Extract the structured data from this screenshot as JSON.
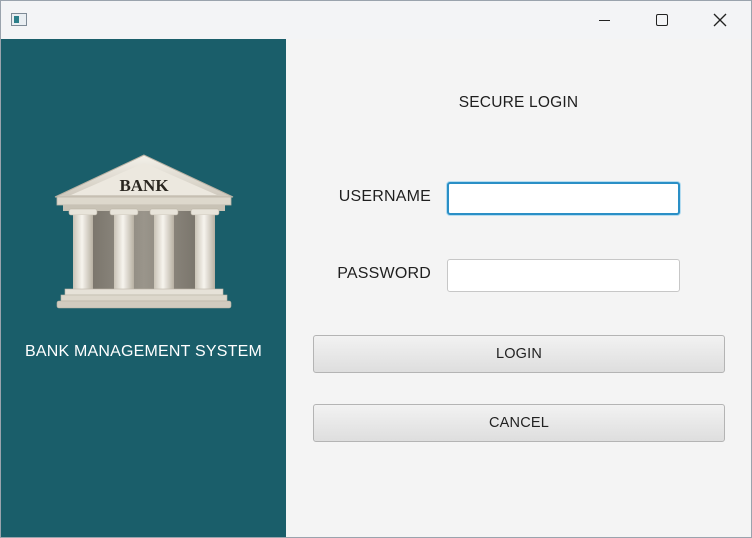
{
  "window": {
    "icon": "app-window-icon",
    "controls": {
      "minimize": "minimize-icon",
      "maximize": "maximize-icon",
      "close": "close-icon"
    }
  },
  "sidebar": {
    "logo_text": "BANK",
    "logo_icon": "bank-building-icon",
    "title": "BANK MANAGEMENT SYSTEM",
    "background": "#1a5e6a"
  },
  "login": {
    "heading": "SECURE LOGIN",
    "username_label": "USERNAME",
    "username_value": "",
    "password_label": "PASSWORD",
    "password_value": "",
    "login_button": "LOGIN",
    "cancel_button": "CANCEL",
    "focus_color": "#2a8fc6"
  }
}
